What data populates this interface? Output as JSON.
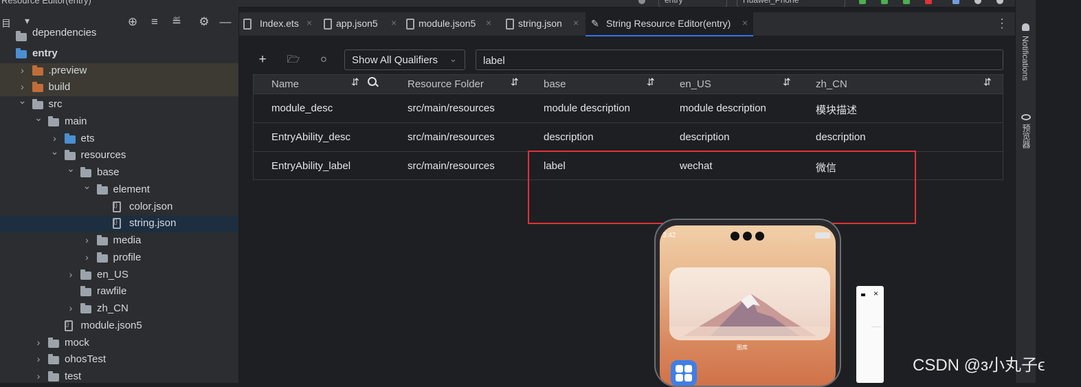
{
  "window": {
    "title": "Resource Editor(entry)",
    "run_config": "entry",
    "device": "Huawei_Phone"
  },
  "project_panel": {
    "header_label": "目",
    "tree": [
      {
        "label": "dependencies",
        "indent": 0,
        "arrow": "",
        "kind": "folder",
        "clipped": true
      },
      {
        "label": "entry",
        "indent": 0,
        "arrow": "",
        "kind": "folder-blue",
        "bold": true
      },
      {
        "label": ".preview",
        "indent": 1,
        "arrow": ">",
        "kind": "folder-orange"
      },
      {
        "label": "build",
        "indent": 1,
        "arrow": ">",
        "kind": "folder-orange"
      },
      {
        "label": "src",
        "indent": 1,
        "arrow": "v",
        "kind": "folder"
      },
      {
        "label": "main",
        "indent": 2,
        "arrow": "v",
        "kind": "folder"
      },
      {
        "label": "ets",
        "indent": 3,
        "arrow": ">",
        "kind": "folder-blue"
      },
      {
        "label": "resources",
        "indent": 3,
        "arrow": "v",
        "kind": "folder"
      },
      {
        "label": "base",
        "indent": 4,
        "arrow": "v",
        "kind": "folder"
      },
      {
        "label": "element",
        "indent": 5,
        "arrow": "v",
        "kind": "folder"
      },
      {
        "label": "color.json",
        "indent": 6,
        "arrow": "",
        "kind": "file"
      },
      {
        "label": "string.json",
        "indent": 6,
        "arrow": "",
        "kind": "file",
        "selected": true
      },
      {
        "label": "media",
        "indent": 5,
        "arrow": ">",
        "kind": "folder"
      },
      {
        "label": "profile",
        "indent": 5,
        "arrow": ">",
        "kind": "folder"
      },
      {
        "label": "en_US",
        "indent": 4,
        "arrow": ">",
        "kind": "folder"
      },
      {
        "label": "rawfile",
        "indent": 4,
        "arrow": "",
        "kind": "folder"
      },
      {
        "label": "zh_CN",
        "indent": 4,
        "arrow": ">",
        "kind": "folder"
      },
      {
        "label": "module.json5",
        "indent": 3,
        "arrow": "",
        "kind": "file"
      },
      {
        "label": "mock",
        "indent": 2,
        "arrow": ">",
        "kind": "folder"
      },
      {
        "label": "ohosTest",
        "indent": 2,
        "arrow": ">",
        "kind": "folder"
      },
      {
        "label": "test",
        "indent": 2,
        "arrow": ">",
        "kind": "folder"
      }
    ]
  },
  "tabs": [
    {
      "label": "Index.ets",
      "active": false
    },
    {
      "label": "app.json5",
      "active": false
    },
    {
      "label": "module.json5",
      "active": false
    },
    {
      "label": "string.json",
      "active": false
    },
    {
      "label": "String Resource Editor(entry)",
      "active": true
    }
  ],
  "editor": {
    "toolbar": {
      "add_icon": "plus-icon",
      "qualifier_filter": "Show All Qualifiers",
      "search_value": "label"
    },
    "columns": [
      "Name",
      "Resource Folder",
      "base",
      "en_US",
      "zh_CN"
    ],
    "rows": [
      [
        "module_desc",
        "src/main/resources",
        "module description",
        "module description",
        "模块描述"
      ],
      [
        "EntryAbility_desc",
        "src/main/resources",
        "description",
        "description",
        "description"
      ],
      [
        "EntryAbility_label",
        "src/main/resources",
        "label",
        "wechat",
        "微信"
      ]
    ]
  },
  "right_sidebar": {
    "notifications": "Notifications",
    "previewer": "预览器"
  },
  "preview": {
    "status_time": "3:42",
    "widget_caption": "图库"
  },
  "watermark": "CSDN @ɜ小丸子ϵ",
  "colors": {
    "accent": "#3574f0",
    "highlight_box": "#e0323a",
    "panel_bg": "#2b2d30",
    "editor_bg": "#1e1f22"
  }
}
